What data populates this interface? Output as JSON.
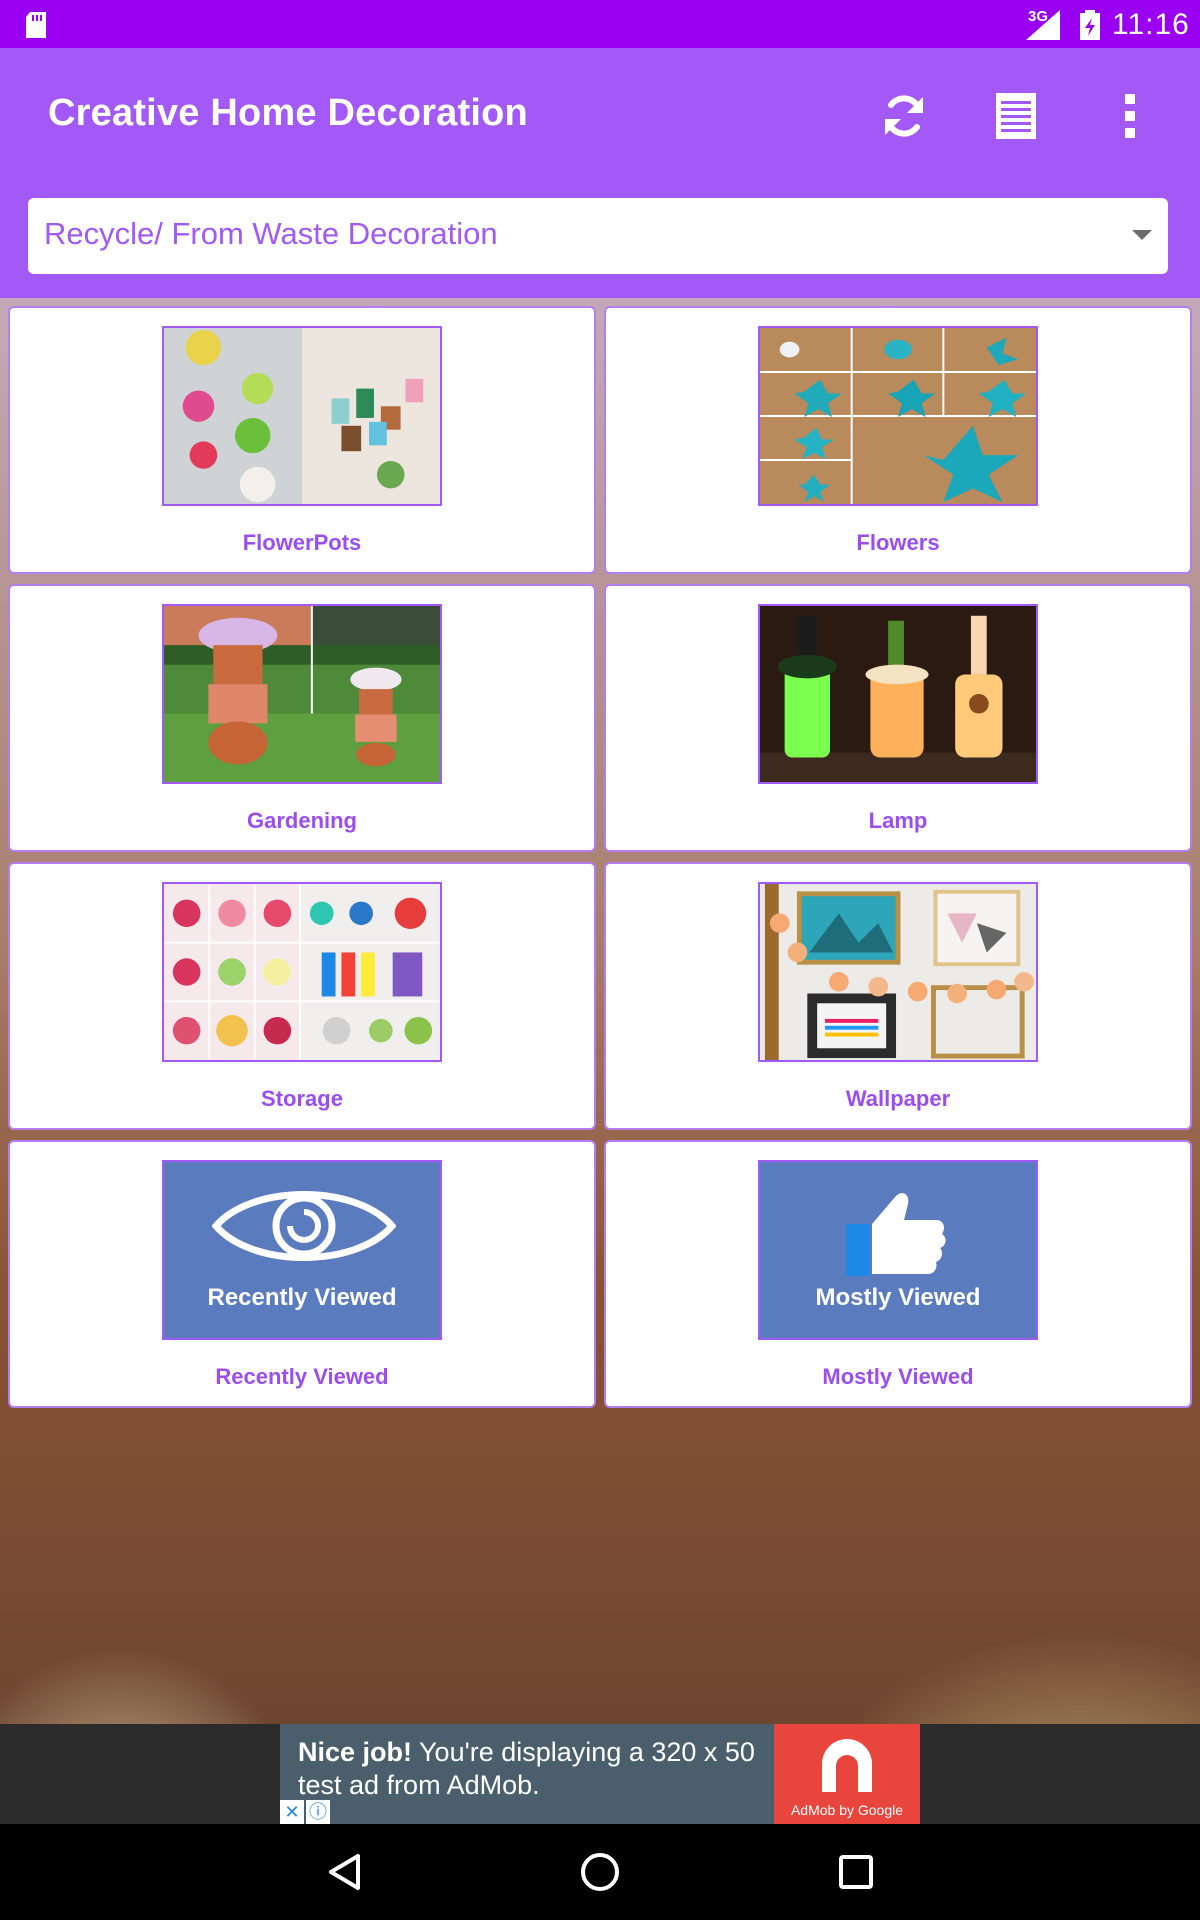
{
  "status_bar": {
    "network": "3G",
    "time": "11:16"
  },
  "toolbar": {
    "title": "Creative Home Decoration",
    "icons": [
      "refresh-icon",
      "list-icon",
      "more-vertical-icon"
    ],
    "category_selector": {
      "selected": "Recycle/ From Waste Decoration"
    }
  },
  "categories": [
    {
      "label": "FlowerPots"
    },
    {
      "label": "Flowers"
    },
    {
      "label": "Gardening"
    },
    {
      "label": "Lamp"
    },
    {
      "label": "Storage"
    },
    {
      "label": "Wallpaper"
    },
    {
      "label": "Recently Viewed",
      "tile_text": "Recently Viewed"
    },
    {
      "label": "Mostly Viewed",
      "tile_text": "Mostly Viewed"
    }
  ],
  "ad": {
    "headline": "Nice job!",
    "body": "You're displaying a 320 x 50 test ad from AdMob.",
    "brand": "AdMob by Google"
  },
  "colors": {
    "status_bar": "#9a00f2",
    "toolbar": "#a259f5",
    "card_label": "#9b4ef0",
    "tile_blue": "#5b7bbf",
    "ad_red": "#e8453c"
  }
}
